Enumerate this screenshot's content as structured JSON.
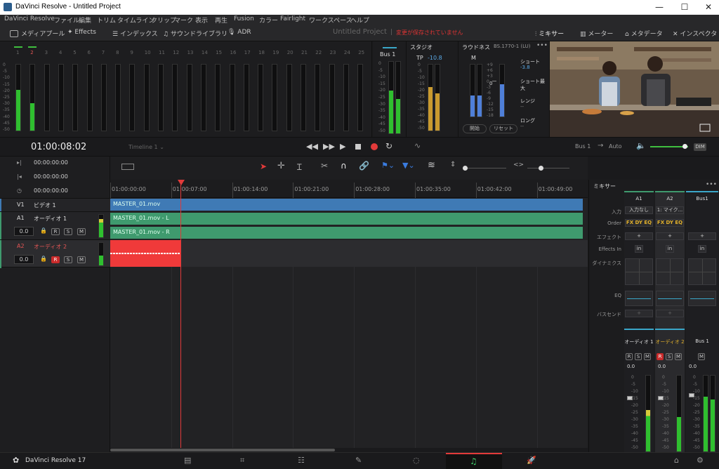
{
  "window": {
    "title": "DaVinci Resolve - Untitled Project",
    "min": "—",
    "max": "☐",
    "close": "✕"
  },
  "menu": [
    "DaVinci Resolve",
    "ファイル",
    "編集",
    "トリム",
    "タイムライン",
    "クリップ",
    "マーク",
    "表示",
    "再生",
    "Fusion",
    "カラー",
    "Fairlight",
    "ワークスペース",
    "ヘルプ"
  ],
  "toolbar": {
    "media_pool": "メディアプール",
    "effects": "Effects",
    "index": "インデックス",
    "sound_library": "サウンドライブラリ",
    "adr": "ADR",
    "project": "Untitled Project",
    "unsaved": "変更が保存されていません",
    "mixer": "ミキサー",
    "meter": "メーター",
    "metadata": "メタデータ",
    "inspector": "インスペクタ"
  },
  "meters": {
    "channels": [
      "1",
      "2",
      "3",
      "4",
      "5",
      "6",
      "7",
      "8",
      "9",
      "10",
      "11",
      "12",
      "13",
      "14",
      "15",
      "16",
      "17",
      "18",
      "19",
      "20",
      "21",
      "22",
      "23",
      "24",
      "25"
    ],
    "scale": [
      "0",
      "-5",
      "-10",
      "-15",
      "-20",
      "-25",
      "-30",
      "-35",
      "-40",
      "-45",
      "-50"
    ],
    "levels": [
      0.62,
      0.42
    ],
    "bus_title": "Bus 1",
    "bus_levels": [
      0.6,
      0.48
    ],
    "bus_scale": [
      "0",
      "-5",
      "-10",
      "-15",
      "-20",
      "-25",
      "-30",
      "-35",
      "-40",
      "-45",
      "-50"
    ]
  },
  "studio": {
    "title": "スタジオ",
    "tp_label": "TP",
    "tp_value": "-10.8",
    "levels": [
      0.66,
      0.56
    ],
    "scale": [
      "0",
      "-5",
      "-10",
      "-15",
      "-20",
      "-25",
      "-30",
      "-35",
      "-40",
      "-45",
      "-50"
    ]
  },
  "loudness": {
    "title": "ラウドネス",
    "standard": "BS.1770-1 (LU)",
    "m_label": "M",
    "short": "ショート",
    "short_value": "-3.8",
    "short_max": "ショート最大",
    "range": "レンジ",
    "long": "ロング",
    "start_btn": "開始",
    "reset_btn": "リセット",
    "levels": [
      0.4,
      0.62
    ],
    "scale_left": [
      "+9",
      "+6",
      "+3",
      "0",
      "-3",
      "-6",
      "-9",
      "-12",
      "-15",
      "-18"
    ],
    "scale_right": [
      "+9",
      "+6",
      "+3",
      "0",
      "-3",
      "-6",
      "-9",
      "-12",
      "-15",
      "-18"
    ],
    "dash": "--"
  },
  "transport": {
    "timecode": "01:00:08:02",
    "timeline": "Timeline 1",
    "bus": "Bus 1",
    "auto": "Auto",
    "dim": "DIM",
    "volume": 0.9
  },
  "left": {
    "tc_rows": [
      "00:00:00:00",
      "00:00:00:00",
      "00:00:00:00"
    ],
    "tracks": [
      {
        "id": "V1",
        "name": "ビデオ 1"
      },
      {
        "id": "A1",
        "name": "オーディオ 1",
        "vol": "0.0",
        "r": "R",
        "s": "S",
        "m": "M",
        "level": 0.8
      },
      {
        "id": "A2",
        "name": "オーディオ 2",
        "vol": "0.0",
        "r": "R",
        "s": "S",
        "m": "M",
        "level": 0.45
      }
    ]
  },
  "ruler": [
    "01:00:00:00",
    "01:00:07:00",
    "01:00:14:00",
    "01:00:21:00",
    "01:00:28:00",
    "01:00:35:00",
    "01:00:42:00",
    "01:00:49:00"
  ],
  "clips": {
    "video": "MASTER_01.mov",
    "audio_l": "MASTER_01.mov - L",
    "audio_r": "MASTER_01.mov - R"
  },
  "mixer": {
    "title": "ミキサー",
    "labels": {
      "input": "入力",
      "order": "Order",
      "effect": "エフェクト",
      "effects_in": "Effects In",
      "dynamics": "ダイナミクス",
      "eq": "EQ",
      "bus_send": "バスセンド"
    },
    "columns": [
      {
        "head": "A1",
        "input": "入力なし",
        "name": "オーディオ 1",
        "gain": "0.0",
        "level": 0.55
      },
      {
        "head": "A2",
        "input": "1: マイク...",
        "name": "オーディオ 2",
        "gain": "0.0",
        "level": 0.45
      },
      {
        "head": "Bus1",
        "input": "",
        "name": "Bus 1",
        "gain": "0.0",
        "level": 0.72
      }
    ],
    "fx_order": "FX DY EQ",
    "plus": "+",
    "in": "in",
    "fader_scale": [
      "0",
      "-5",
      "-10",
      "-15",
      "-20",
      "-25",
      "-30",
      "-35",
      "-40",
      "-45",
      "-50"
    ]
  },
  "bottom": {
    "app": "DaVinci Resolve 17"
  },
  "colors": {
    "accent_red": "#e23a3a",
    "video_clip": "#3f7ab5",
    "audio_clip": "#3f9a6e",
    "meter_green": "#2fbf2f",
    "loud_blue": "#4f7fd8"
  }
}
